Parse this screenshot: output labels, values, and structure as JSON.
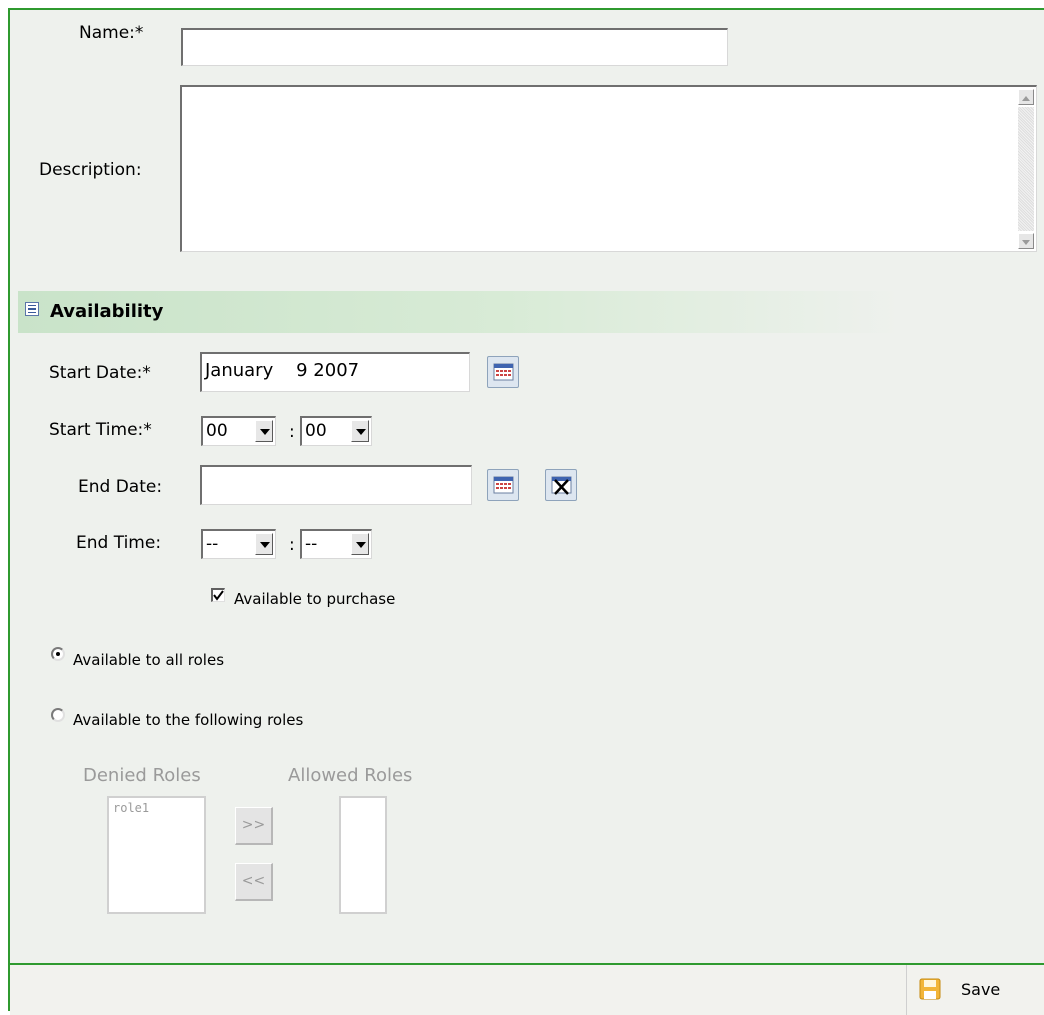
{
  "form": {
    "name_label": "Name:*",
    "name_value": "",
    "description_label": "Description:",
    "description_value": ""
  },
  "availability": {
    "section_title": "Availability",
    "collapse_symbol": "⊟",
    "start_date_label": "Start Date:*",
    "start_date_value": "January    9 2007",
    "start_time_label": "Start Time:*",
    "start_hour": "00",
    "start_minute": "00",
    "end_date_label": "End Date:",
    "end_date_value": "",
    "end_time_label": "End Time:",
    "end_hour": "--",
    "end_minute": "--",
    "time_separator": ":",
    "purchase_label": "Available to purchase",
    "purchase_checked": true,
    "all_roles_label": "Available to all roles",
    "following_roles_label": "Available to the following roles",
    "selected_roles_option": "all"
  },
  "roles": {
    "denied_header": "Denied Roles",
    "allowed_header": "Allowed Roles",
    "denied_items": [
      "role1"
    ],
    "allowed_items": [],
    "move_right_label": ">>",
    "move_left_label": "<<"
  },
  "footer": {
    "save_label": "Save"
  },
  "icons": {
    "calendar": "calendar-icon",
    "clear": "clear-date-icon",
    "save": "floppy-disk-icon"
  },
  "colors": {
    "border_green": "#2f9a2f",
    "section_band": "#d3e6d3",
    "form_background": "#eef1ed"
  }
}
